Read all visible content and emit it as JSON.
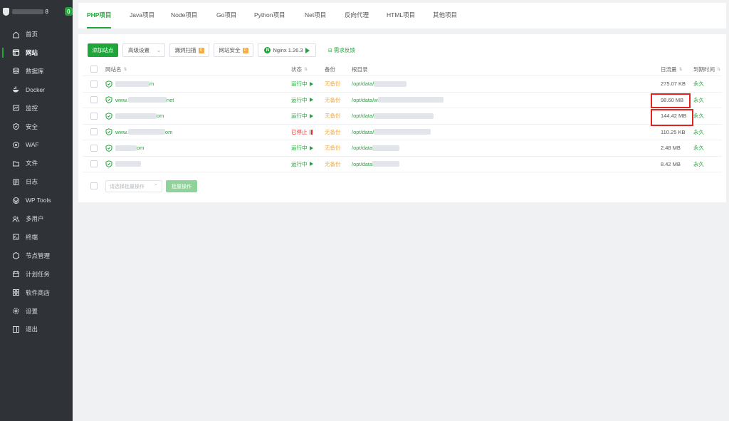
{
  "sidebar": {
    "host_suffix": "8",
    "badge": "0",
    "items": [
      {
        "label": "首页",
        "icon": "home-icon"
      },
      {
        "label": "网站",
        "icon": "website-icon",
        "active": true
      },
      {
        "label": "数据库",
        "icon": "database-icon"
      },
      {
        "label": "Docker",
        "icon": "docker-icon"
      },
      {
        "label": "监控",
        "icon": "monitor-icon"
      },
      {
        "label": "安全",
        "icon": "shield-icon"
      },
      {
        "label": "WAF",
        "icon": "waf-icon"
      },
      {
        "label": "文件",
        "icon": "folder-icon"
      },
      {
        "label": "日志",
        "icon": "log-icon"
      },
      {
        "label": "WP Tools",
        "icon": "wordpress-icon"
      },
      {
        "label": "多用户",
        "icon": "users-icon"
      },
      {
        "label": "终端",
        "icon": "terminal-icon"
      },
      {
        "label": "节点管理",
        "icon": "node-icon"
      },
      {
        "label": "计划任务",
        "icon": "calendar-icon"
      },
      {
        "label": "软件商店",
        "icon": "store-icon"
      },
      {
        "label": "设置",
        "icon": "gear-icon"
      },
      {
        "label": "退出",
        "icon": "logout-icon"
      }
    ]
  },
  "tabs": [
    "PHP项目",
    "Java项目",
    "Node项目",
    "Go项目",
    "Python项目",
    "Net项目",
    "反向代理",
    "HTML项目",
    "其他项目"
  ],
  "toolbar": {
    "add_site": "添加站点",
    "advanced": "高级设置",
    "vuln_scan": "漏洞扫描",
    "vuln_count": "0",
    "site_security": "网站安全",
    "security_count": "0",
    "nginx": "Nginx 1.26.3",
    "feedback": "需求反馈"
  },
  "table": {
    "headers": {
      "name": "网站名",
      "status": "状态",
      "backup": "备份",
      "root": "根目录",
      "traffic": "日流量",
      "expire": "到期时间"
    },
    "rows": [
      {
        "name_prefix": "",
        "name_suffix": "m",
        "status": "运行中",
        "running": true,
        "backup": "无备份",
        "root": "/opt/data/",
        "traffic": "275.07 KB",
        "expire": "永久"
      },
      {
        "name_prefix": "www.",
        "name_suffix": "net",
        "status": "运行中",
        "running": true,
        "backup": "无备份",
        "root": "/opt/data/w",
        "traffic": "98.60 MB",
        "expire": "永久"
      },
      {
        "name_prefix": "",
        "name_suffix": "om",
        "status": "运行中",
        "running": true,
        "backup": "无备份",
        "root": "/opt/data/",
        "traffic": "144.42 MB",
        "expire": "永久"
      },
      {
        "name_prefix": "www.",
        "name_suffix": "om",
        "status": "已停止",
        "running": false,
        "backup": "无备份",
        "root": "/opt/data/",
        "traffic": "110.25 KB",
        "expire": "永久"
      },
      {
        "name_prefix": "",
        "name_suffix": "om",
        "status": "运行中",
        "running": true,
        "backup": "无备份",
        "root": "/opt/data",
        "traffic": "2.48 MB",
        "expire": "永久"
      },
      {
        "name_prefix": "",
        "name_suffix": "",
        "status": "运行中",
        "running": true,
        "backup": "无备份",
        "root": "/opt/data",
        "traffic": "8.42 MB",
        "expire": "永久"
      }
    ]
  },
  "batch": {
    "placeholder": "请选择批量操作",
    "button": "批量操作"
  },
  "colors": {
    "accent": "#20a53a",
    "sidebar_bg": "#2f3338",
    "stopped": "#e5322d",
    "no_backup": "#f0ad4e",
    "highlight": "#e02424"
  }
}
